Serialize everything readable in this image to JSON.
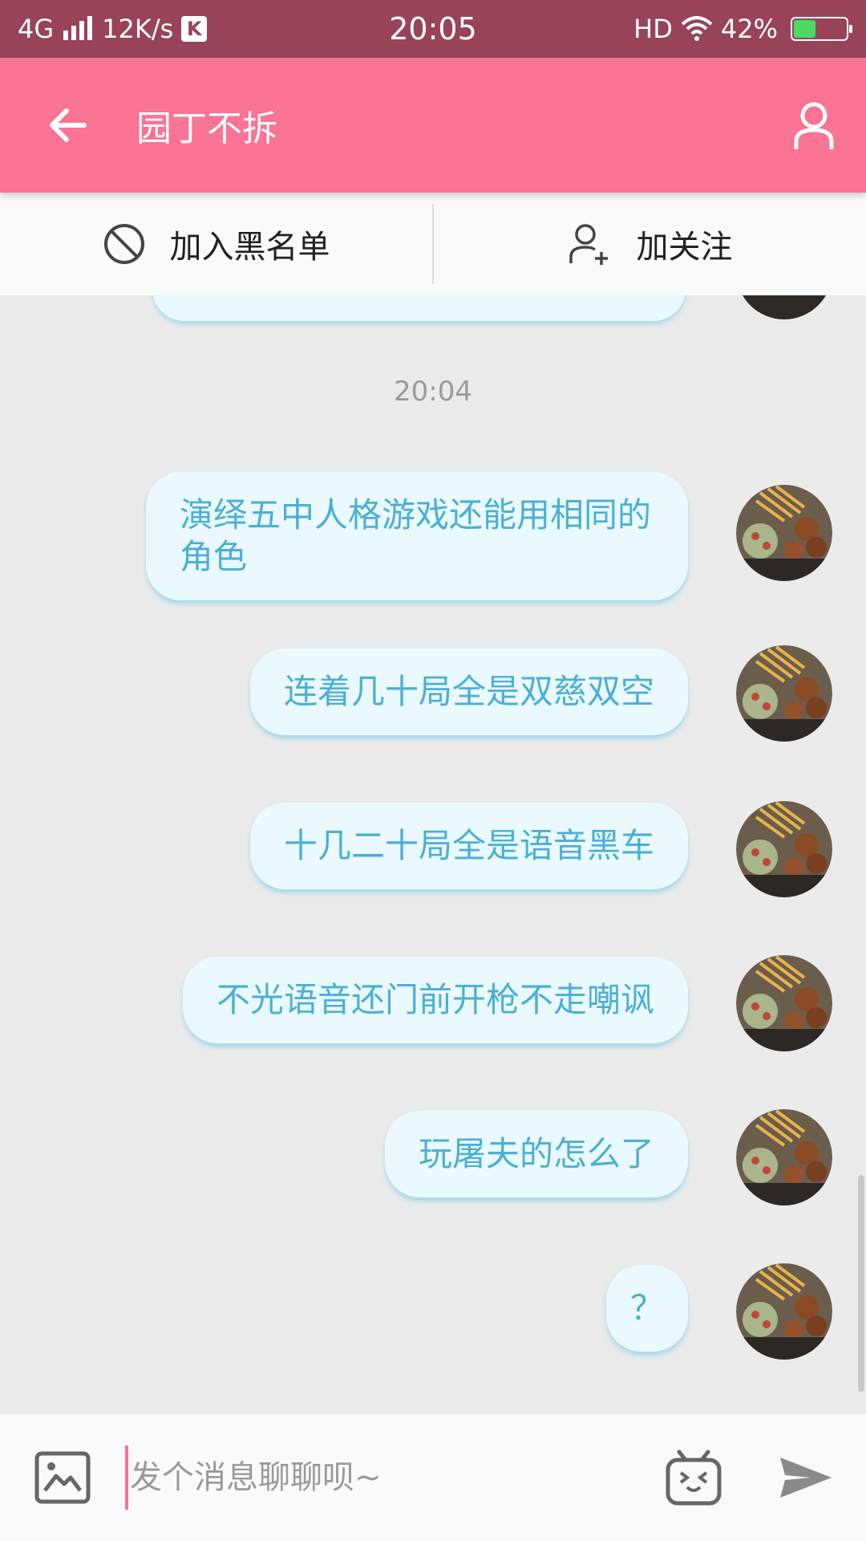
{
  "status_bar": {
    "network": "4G",
    "speed": "12K/s",
    "k_badge": "K",
    "time": "20:05",
    "hd": "HD",
    "battery_percent": "42%",
    "battery_level": 0.42
  },
  "app_bar": {
    "title": "园丁不拆",
    "back_icon": "arrow-left-icon",
    "profile_icon": "person-icon",
    "color": "#fb7395"
  },
  "actions": {
    "block_label": "加入黑名单",
    "follow_label": "加关注"
  },
  "chat": {
    "timestamp": "20:04",
    "messages": [
      {
        "text": "演绎五中人格游戏还能用相同的角色"
      },
      {
        "text": "连着几十局全是双慈双空"
      },
      {
        "text": "十几二十局全是语音黑车"
      },
      {
        "text": "不光语音还门前开枪不走嘲讽"
      },
      {
        "text": "玩屠夫的怎么了"
      },
      {
        "text": "？"
      }
    ]
  },
  "input": {
    "placeholder": "发个消息聊聊呗~",
    "value": ""
  }
}
